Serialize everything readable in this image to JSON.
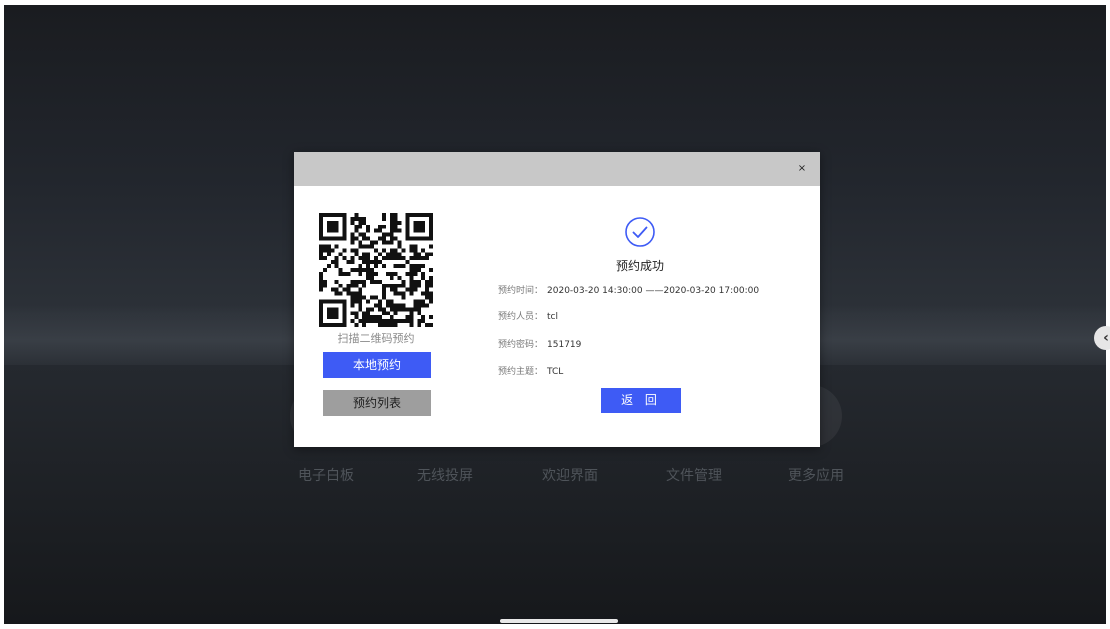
{
  "background": {
    "apps": [
      {
        "label": "电子白板",
        "icon": "whiteboard-icon"
      },
      {
        "label": "无线投屏",
        "icon": "screencast-icon"
      },
      {
        "label": "欢迎界面",
        "icon": "welcome-icon"
      },
      {
        "label": "文件管理",
        "icon": "file-manager-icon"
      },
      {
        "label": "更多应用",
        "icon": "more-apps-icon"
      }
    ]
  },
  "dialog": {
    "close_label": "×",
    "qr_caption": "扫描二维码预约",
    "local_booking_label": "本地预约",
    "booking_list_label": "预约列表",
    "success_icon": "check-circle-icon",
    "success_text": "预约成功",
    "info": [
      {
        "label": "预约时间：",
        "value": "2020-03-20 14:30:00 ——2020-03-20 17:00:00"
      },
      {
        "label": "预约人员：",
        "value": "tcl"
      },
      {
        "label": "预约密码：",
        "value": "151719"
      },
      {
        "label": "预约主题：",
        "value": "TCL"
      }
    ],
    "back_label": "返 回"
  },
  "colors": {
    "accent": "#3e5bf5",
    "header": "#c8c8c8",
    "secondary_button": "#9e9e9e"
  }
}
